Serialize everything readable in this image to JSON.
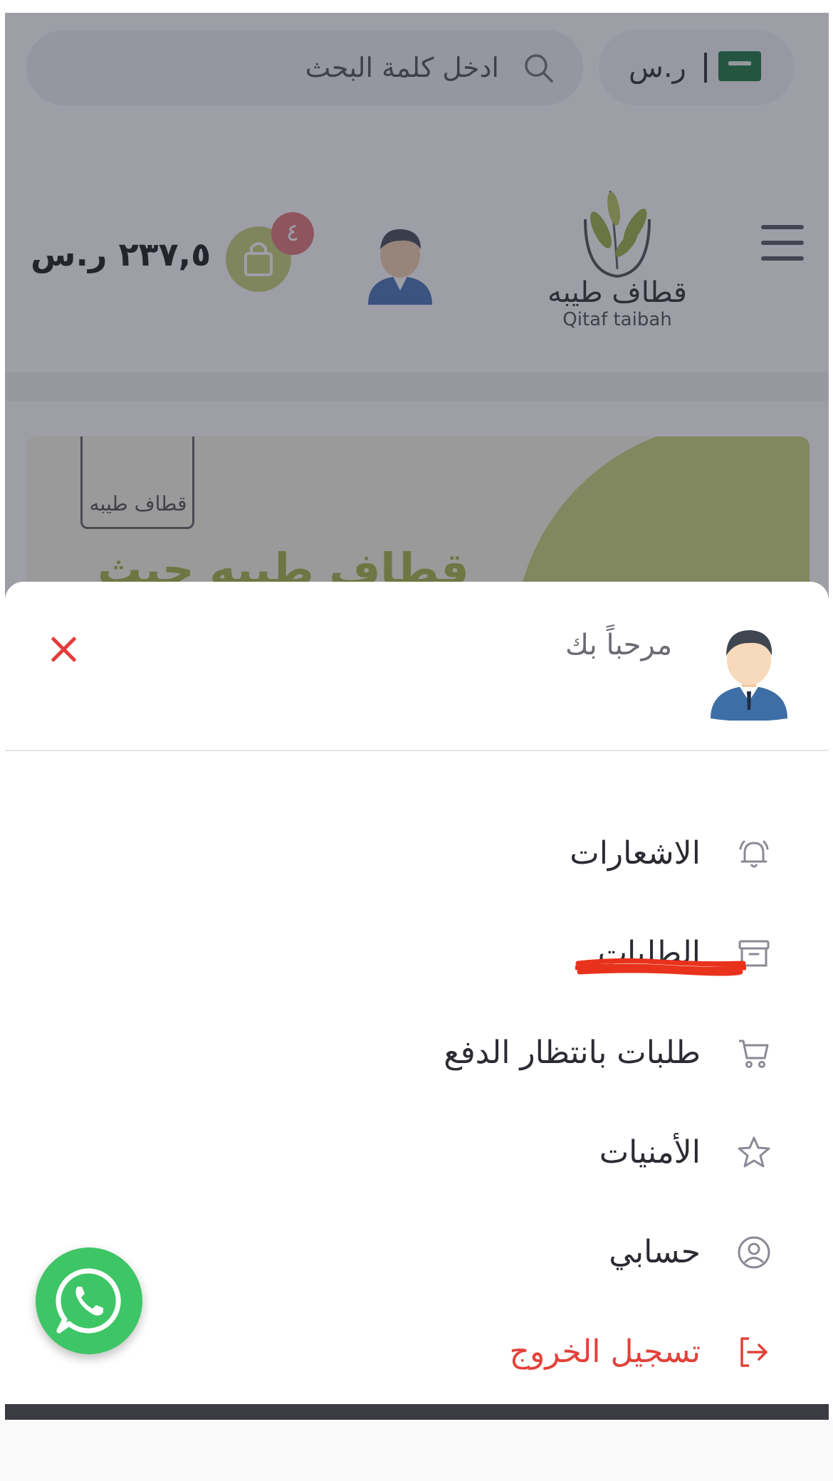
{
  "header": {
    "search_placeholder": "ادخل كلمة البحث",
    "currency": "ر.س",
    "cart_count": "٤",
    "cart_total": "٢٣٧,٥ ر.س"
  },
  "logo": {
    "arabic": "قطاف طيبه",
    "english": "Qitaf taibah"
  },
  "banner": {
    "title": "قطاف طيبه حيث"
  },
  "menu": {
    "welcome": "مرحباً بك",
    "username": "........",
    "items": [
      {
        "label": "الاشعارات",
        "icon": "bell-icon"
      },
      {
        "label": "الطلبات",
        "icon": "archive-box-icon"
      },
      {
        "label": "طلبات بانتظار الدفع",
        "icon": "cart-icon"
      },
      {
        "label": "الأمنيات",
        "icon": "star-icon"
      },
      {
        "label": "حسابي",
        "icon": "user-circle-icon"
      },
      {
        "label": "تسجيل الخروج",
        "icon": "logout-icon"
      }
    ]
  },
  "colors": {
    "accent": "#c7d37b",
    "danger": "#e1423a",
    "whatsapp": "#3ec565",
    "icon": "#8a8a96"
  }
}
